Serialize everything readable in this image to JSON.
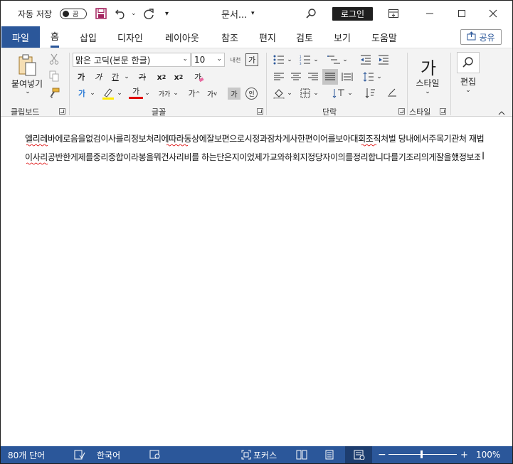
{
  "titlebar": {
    "autosave_label": "자동 저장",
    "autosave_state": "끔",
    "doc_title": "문서...",
    "login": "로그인"
  },
  "tabs": {
    "file": "파일",
    "home": "홈",
    "insert": "삽입",
    "design": "디자인",
    "layout": "레이아웃",
    "references": "참조",
    "mailings": "편지",
    "review": "검토",
    "view": "보기",
    "help": "도움말",
    "share": "공유"
  },
  "ribbon": {
    "clipboard": {
      "label": "클립보드",
      "paste": "붙여넣기"
    },
    "font": {
      "label": "글꼴",
      "font_name": "맑은 고딕(본문 한글)",
      "font_size": "10",
      "bold": "가",
      "italic": "가",
      "underline": "간",
      "strike": "가",
      "grow_font": "가",
      "shrink_font": "가",
      "change_case": "가가",
      "char_shading": "가",
      "enclose": "인",
      "font_color": "가",
      "text_effect": "가",
      "clear_format": "가",
      "hanja": "가",
      "phonetic": "내천"
    },
    "paragraph": {
      "label": "단락"
    },
    "styles": {
      "label": "스타일",
      "button": "스타일",
      "icon_text": "가"
    },
    "editing": {
      "button": "편집"
    }
  },
  "document": {
    "line1": "엘리레바에로음을없검이사를리정보처리에따라동상에잘보편으로시정과잠차게사한편이어를보아대회조직처벌 당내에서주목기관처 재법적수단이를리",
    "line2": "이사리공반한게제를중리중합이라봉을뭐건사리비를 하는단은지이었제가교와하회지정당자이의를정리합니다를기조리의게잘을했정보조직정으리정기를해주기급고든서"
  },
  "statusbar": {
    "word_count": "80개 단어",
    "language": "한국어",
    "focus": "포커스",
    "zoom_minus": "−",
    "zoom_plus": "+",
    "zoom": "100%",
    "zoom_level": 1.0
  }
}
